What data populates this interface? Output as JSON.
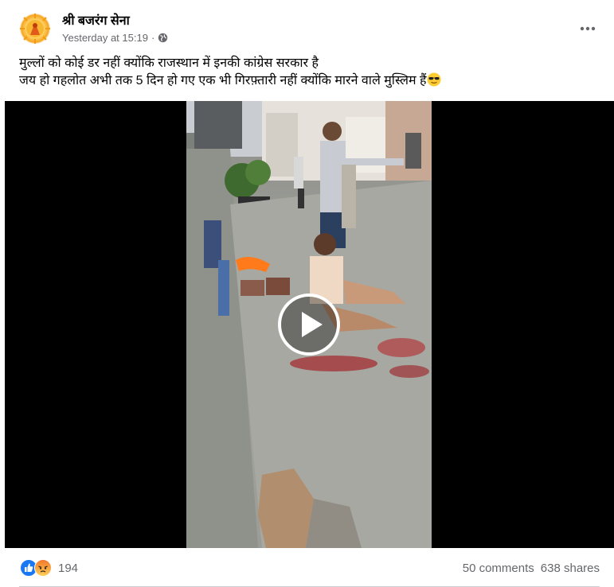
{
  "post": {
    "page_name": "श्री बजरंग सेना",
    "timestamp": "Yesterday at 15:19",
    "separator": "·",
    "privacy_icon": "globe-icon",
    "more_icon": "more-options-icon",
    "caption_line1": "मुल्लों को कोई डर नहीं क्योंकि राजस्थान में इनकी कांग्रेस सरकार है",
    "caption_line2": "जय हो गहलोत अभी तक 5 दिन हो गए एक भी गिरफ़्तारी नहीं क्योंकि मारने वाले मुस्लिम हैं",
    "caption_emoji": "sunglasses-emoji"
  },
  "video": {
    "play_icon": "play-icon"
  },
  "stats": {
    "reaction_icons": [
      "like-icon",
      "angry-icon"
    ],
    "reaction_count": "194",
    "comments": "50 comments",
    "shares": "638 shares"
  },
  "colors": {
    "brand_blue": "#1877f2",
    "secondary_text": "#65676b",
    "angry": "#f0752a"
  }
}
